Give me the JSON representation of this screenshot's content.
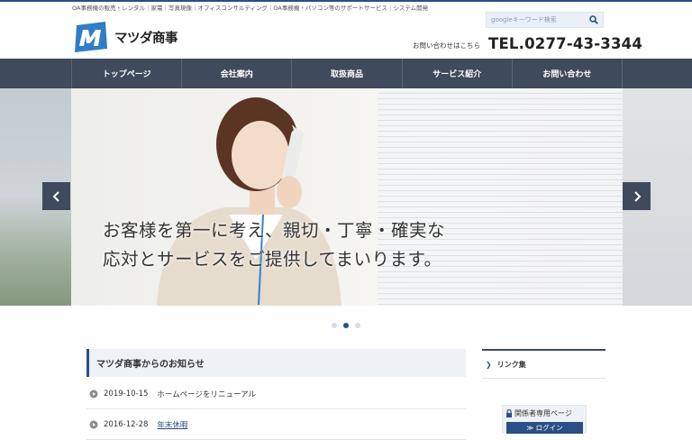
{
  "header": {
    "tagline": "OA事務機の販売・レンタル｜家電｜写真現像｜オフィスコンサルティング｜OA事務機・パソコン等のサポートサービス｜システム開発",
    "logo_text": "マツダ商事",
    "search": {
      "placeholder": "googleキーワード検索",
      "icon": "search-icon"
    },
    "contact_label": "お問い合わせはこちら",
    "tel": "TEL.0277-43-3344"
  },
  "nav": {
    "items": [
      {
        "label": "トップページ"
      },
      {
        "label": "会社案内"
      },
      {
        "label": "取扱商品"
      },
      {
        "label": "サービス紹介"
      },
      {
        "label": "お問い合わせ"
      }
    ]
  },
  "hero": {
    "caption_line1": "お客様を第一に考え、親切・丁寧・確実な",
    "caption_line2": "応対とサービスをご提供してまいります。",
    "prev_icon": "chevron-left-icon",
    "next_icon": "chevron-right-icon",
    "slides_total": 3,
    "active_slide": 2
  },
  "news": {
    "heading": "マツダ商事からのお知らせ",
    "items": [
      {
        "date": "2019-10-15",
        "title": "ホームページをリニューアル",
        "link": false
      },
      {
        "date": "2016-12-28",
        "title": "年末休暇",
        "link": true
      }
    ]
  },
  "sidebar": {
    "links_label": "リンク集",
    "members_label": "関係者専用ページ",
    "login_label": "≫ ログイン"
  },
  "colors": {
    "brand": "#2b4f86",
    "nav_bg": "#3f4a5c",
    "logo_blue": "#2f7dc8"
  }
}
